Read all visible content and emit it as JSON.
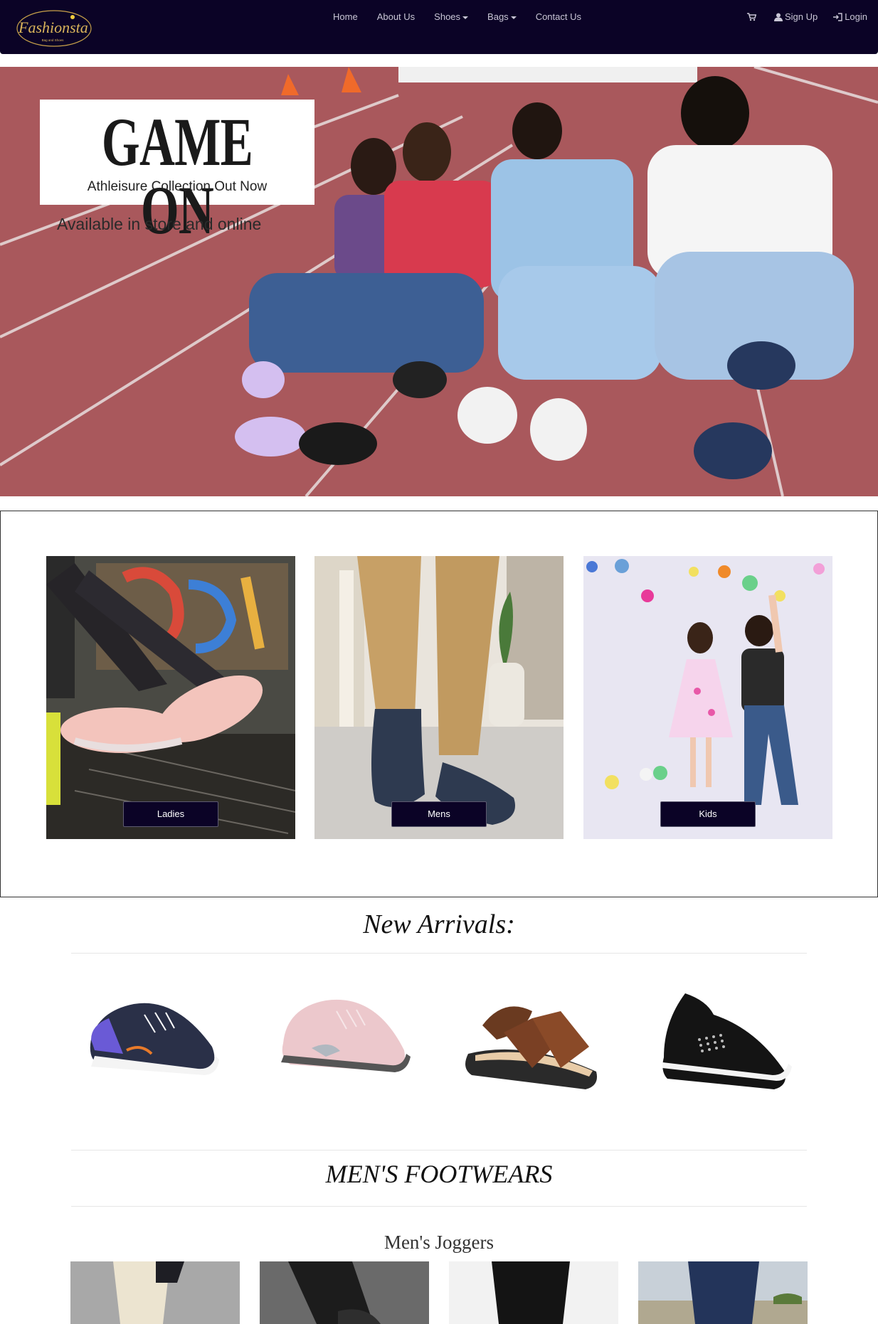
{
  "brand": {
    "logo_text": "Fashionsta",
    "logo_tagline": "Bag and Shoes"
  },
  "nav": {
    "home": "Home",
    "about": "About Us",
    "shoes": "Shoes",
    "bags": "Bags",
    "contact": "Contact Us",
    "signup": "Sign Up",
    "login": "Login"
  },
  "hero": {
    "title": "GAME ON",
    "subtitle": "Athleisure Collection Out Now",
    "availability": "Available in store and online"
  },
  "categories": [
    {
      "label": "Ladies"
    },
    {
      "label": "Mens"
    },
    {
      "label": "Kids"
    }
  ],
  "new_arrivals": {
    "title": "New Arrivals:"
  },
  "mens_section": {
    "title": "MEN'S FOOTWEARS",
    "subtitle": "Men's Joggers"
  },
  "colors": {
    "navbar": "#0b0326",
    "button": "#0b0326",
    "track": "#a9585c"
  },
  "icons": [
    "cart-icon",
    "user-icon",
    "login-icon"
  ]
}
